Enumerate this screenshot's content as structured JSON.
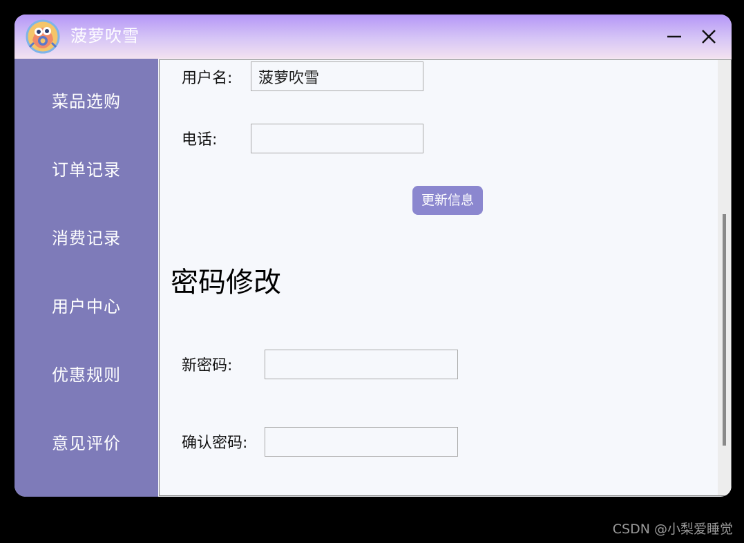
{
  "window": {
    "title": "菠萝吹雪",
    "accent_gradient": [
      "#b496f7",
      "#f3e2f0"
    ],
    "logo_icon": "app-logo-icon",
    "min_icon": "minimize-icon",
    "close_icon": "close-icon"
  },
  "sidebar": {
    "color": "#7e7bb9",
    "items": [
      {
        "label": "菜品选购"
      },
      {
        "label": "订单记录"
      },
      {
        "label": "消费记录"
      },
      {
        "label": "用户中心"
      },
      {
        "label": "优惠规则"
      },
      {
        "label": "意见评价"
      }
    ]
  },
  "profile": {
    "username_label": "用户名:",
    "username_value": "菠萝吹雪",
    "phone_label": "电话:",
    "phone_value": "",
    "update_button": "更新信息",
    "button_color": "#8b87cf"
  },
  "password": {
    "section_title": "密码修改",
    "new_label": "新密码:",
    "new_value": "",
    "confirm_label": "确认密码:",
    "confirm_value": ""
  },
  "watermark": "CSDN @小梨爱睡觉"
}
